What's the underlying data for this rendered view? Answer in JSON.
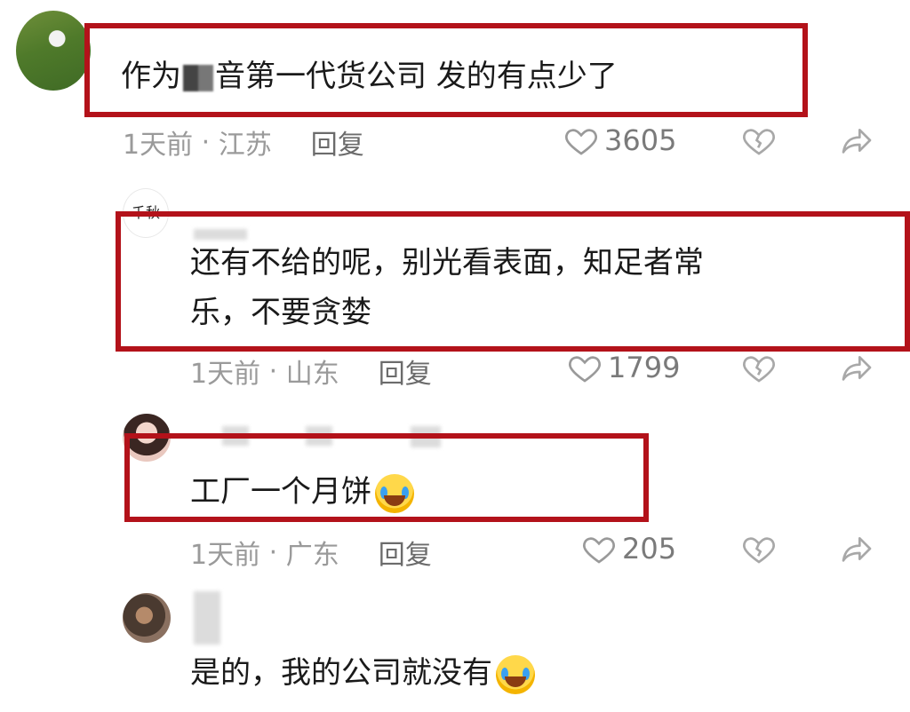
{
  "comments": [
    {
      "text_before": "作为",
      "text_after": "音第一代货公司 发的有点少了",
      "time": "1天前",
      "location": "江苏",
      "reply": "回复",
      "likes": "3605",
      "icons": {
        "like": "heart-outline-icon",
        "dislike": "broken-heart-icon",
        "share": "share-arrow-icon"
      }
    },
    {
      "avatar_text": "千秋",
      "line1": "还有不给的呢，别光看表面，知足者常",
      "line2": "乐，不要贪婪",
      "time": "1天前",
      "location": "山东",
      "reply": "回复",
      "likes": "1799"
    },
    {
      "text": "工厂一个月饼",
      "emoji": "laughing-crying-emoji",
      "time": "1天前",
      "location": "广东",
      "reply": "回复",
      "likes": "205"
    },
    {
      "text": "是的，我的公司就没有",
      "emoji": "crying-emoji"
    }
  ],
  "highlight_color": "#b3121a"
}
